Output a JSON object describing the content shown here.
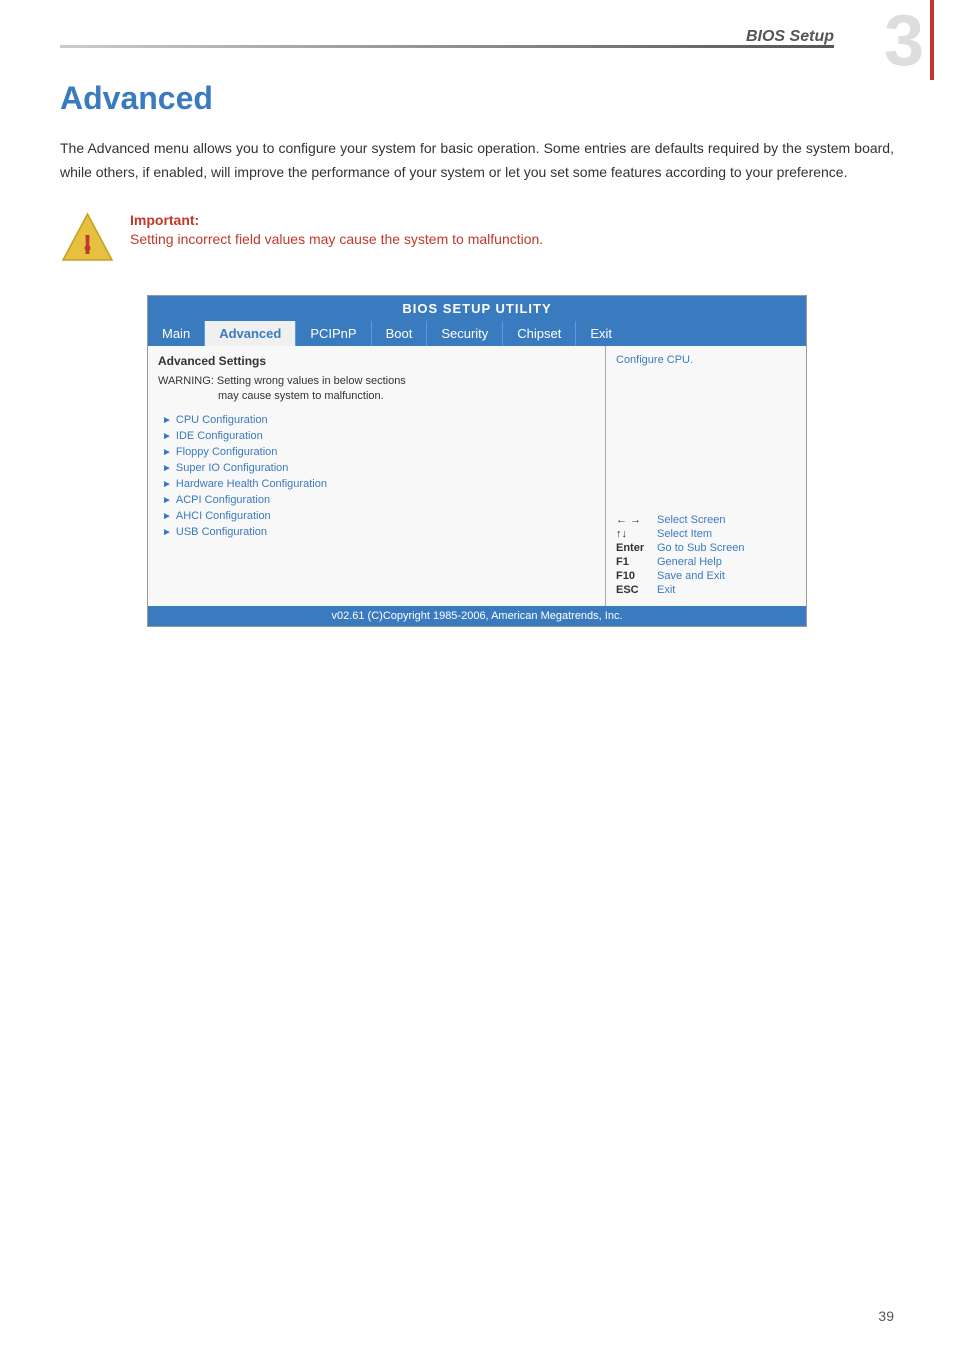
{
  "header": {
    "bios_label": "BIOS Setup",
    "chapter_number": "3"
  },
  "page": {
    "title": "Advanced",
    "description": "The Advanced menu allows you to configure your system for basic operation. Some entries are defaults required by the system board, while others, if enabled, will improve the performance of your system or let you set some features according to your preference.",
    "important_label": "Important:",
    "important_text": "Setting incorrect field values may cause the system to malfunction.",
    "page_number": "39"
  },
  "bios": {
    "title": "BIOS SETUP UTILITY",
    "nav_items": [
      {
        "label": "Main",
        "active": false
      },
      {
        "label": "Advanced",
        "active": true
      },
      {
        "label": "PCIPnP",
        "active": false
      },
      {
        "label": "Boot",
        "active": false
      },
      {
        "label": "Security",
        "active": false
      },
      {
        "label": "Chipset",
        "active": false
      },
      {
        "label": "Exit",
        "active": false
      }
    ],
    "left_section_title": "Advanced Settings",
    "warning_line1": "WARNING: Setting wrong values in below sections",
    "warning_line2": "may cause system to malfunction.",
    "menu_items": [
      "CPU Configuration",
      "IDE Configuration",
      "Floppy Configuration",
      "Super IO Configuration",
      "Hardware Health Configuration",
      "ACPI Configuration",
      "AHCI Configuration",
      "USB Configuration"
    ],
    "right_help": "Configure CPU.",
    "keys": [
      {
        "key": "← →",
        "desc": "Select Screen"
      },
      {
        "key": "↑↓",
        "desc": "Select Item"
      },
      {
        "key": "Enter",
        "desc": "Go to Sub Screen"
      },
      {
        "key": "F1",
        "desc": "General Help"
      },
      {
        "key": "F10",
        "desc": "Save and Exit"
      },
      {
        "key": "ESC",
        "desc": "Exit"
      }
    ],
    "footer": "v02.61 (C)Copyright 1985-2006, American Megatrends, Inc."
  }
}
